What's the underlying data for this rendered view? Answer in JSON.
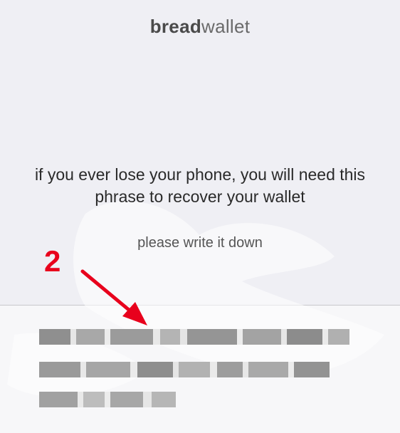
{
  "logo": {
    "bold": "bread",
    "light": "wallet"
  },
  "message": {
    "warning": "if you ever lose your phone, you will need this phrase to recover your wallet",
    "instruction": "please write it down"
  },
  "annotation": {
    "step_number": "2",
    "color": "#e8001c"
  },
  "recovery_phrase": {
    "state": "pixelated / obscured",
    "visible_text": ""
  },
  "colors": {
    "background_top": "#efeff4",
    "background_bottom": "#f7f7f9",
    "text_primary": "#2a2a2a",
    "text_secondary": "#555555"
  }
}
